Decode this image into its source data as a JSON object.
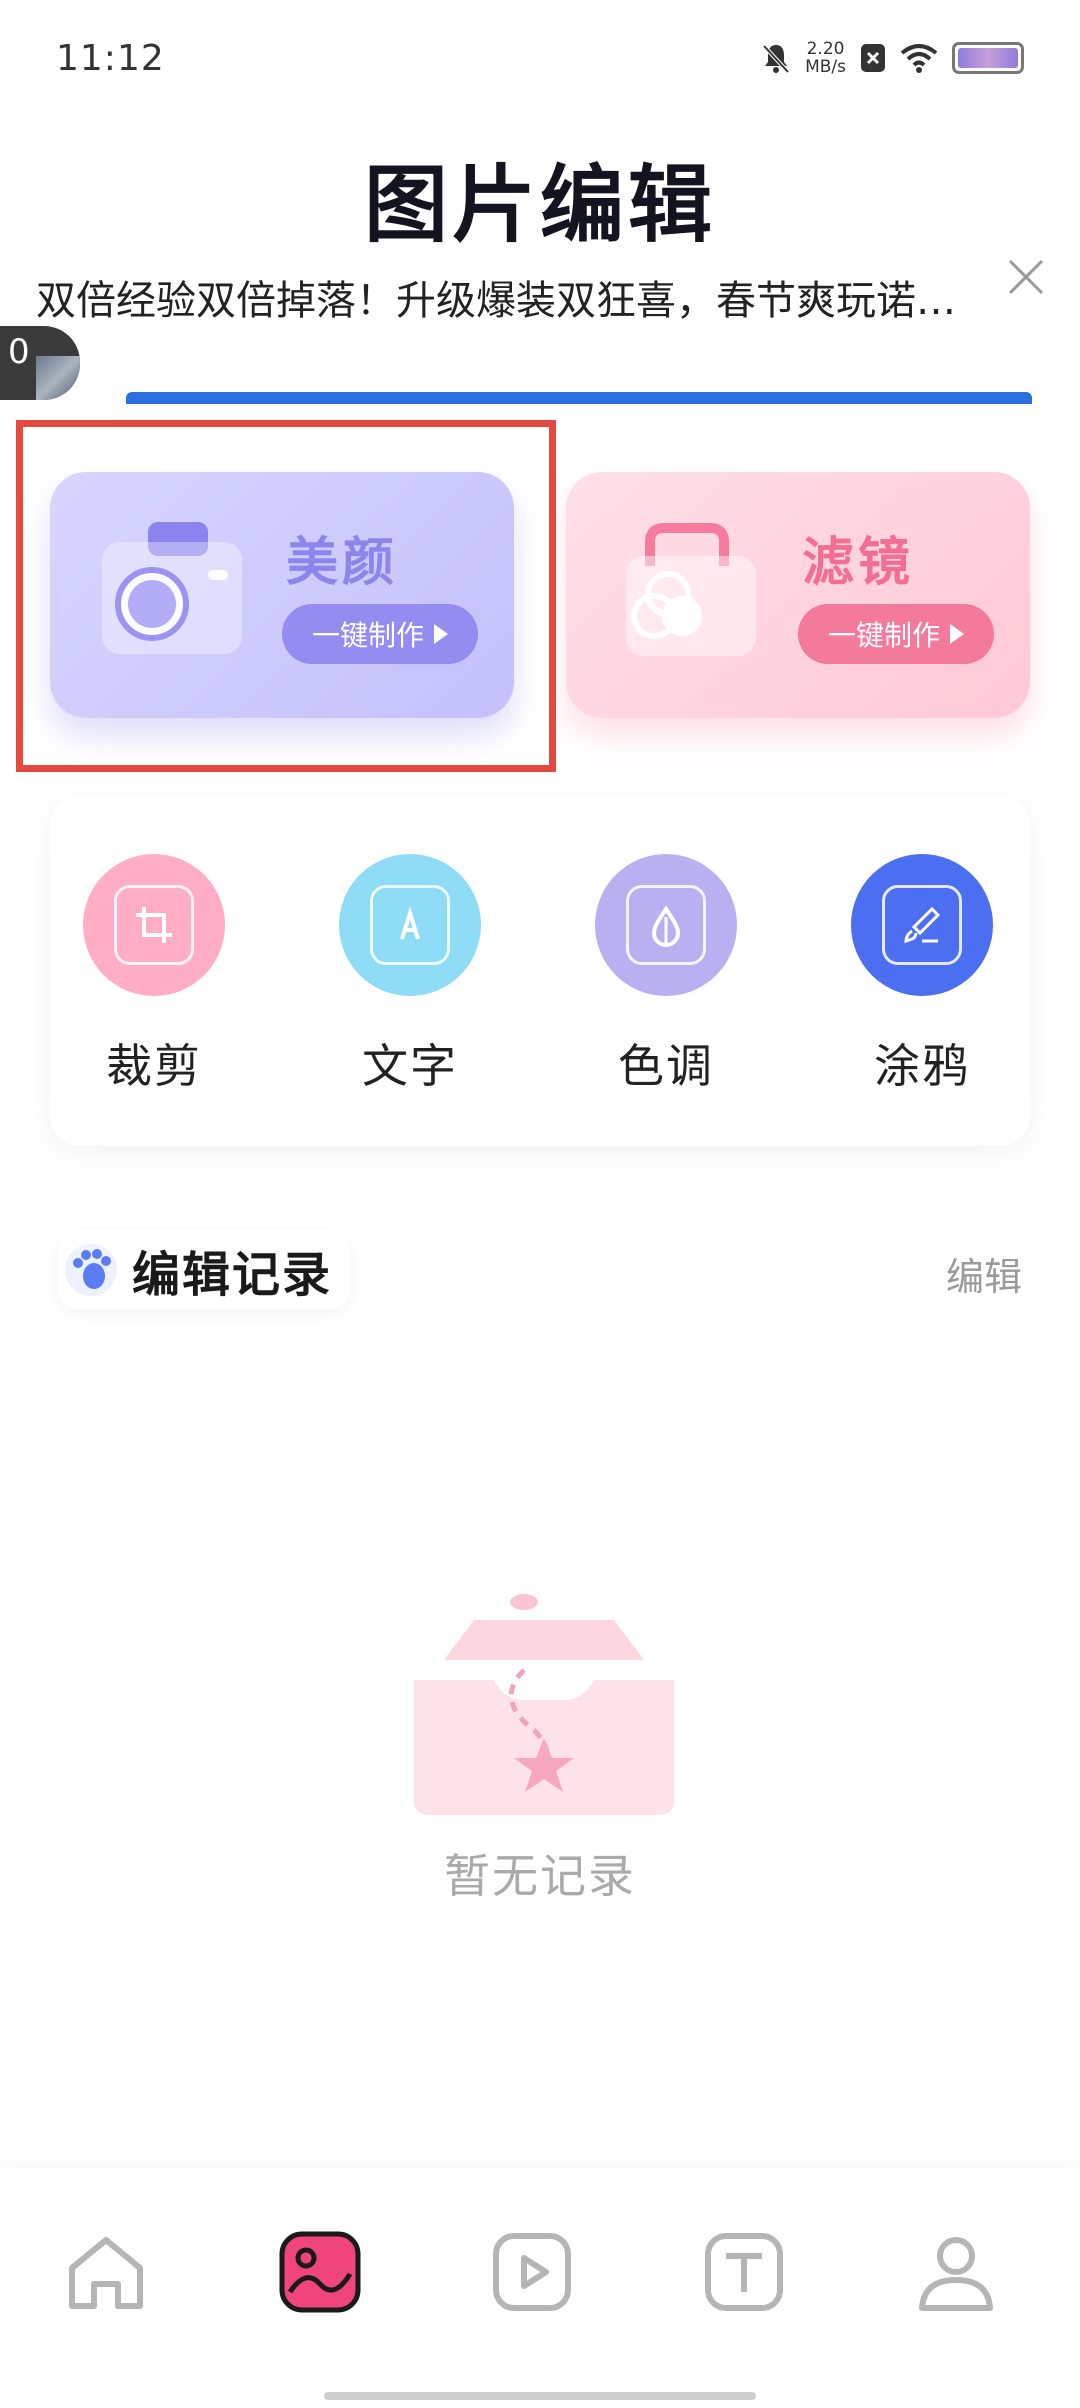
{
  "status_bar": {
    "time": "11:12",
    "net_speed_value": "2.20",
    "net_speed_unit": "MB/s"
  },
  "page_title": "图片编辑",
  "marquee_text": "双倍经验双倍掉落！升级爆装双狂喜，春节爽玩诺…",
  "mini_widget": {
    "label": "0"
  },
  "feature_cards": [
    {
      "title": "美颜",
      "button": "一键制作",
      "icon": "camera-icon",
      "accent": "#948cf0"
    },
    {
      "title": "滤镜",
      "button": "一键制作",
      "icon": "filter-bag-icon",
      "accent": "#f47a9c"
    }
  ],
  "tools": [
    {
      "label": "裁剪",
      "icon": "crop-icon",
      "color": "#ffaec6"
    },
    {
      "label": "文字",
      "icon": "text-icon",
      "color": "#8fdcf6"
    },
    {
      "label": "色调",
      "icon": "tone-icon",
      "color": "#b9b0f2"
    },
    {
      "label": "涂鸦",
      "icon": "brush-icon",
      "color": "#4c6ef0"
    }
  ],
  "history": {
    "title": "编辑记录",
    "edit_label": "编辑",
    "empty_text": "暂无记录"
  },
  "bottom_nav": [
    {
      "name": "home",
      "icon": "home-icon"
    },
    {
      "name": "image-edit",
      "icon": "image-edit-icon",
      "active": true
    },
    {
      "name": "video",
      "icon": "video-icon"
    },
    {
      "name": "text",
      "icon": "text-template-icon"
    },
    {
      "name": "profile",
      "icon": "profile-icon"
    }
  ]
}
